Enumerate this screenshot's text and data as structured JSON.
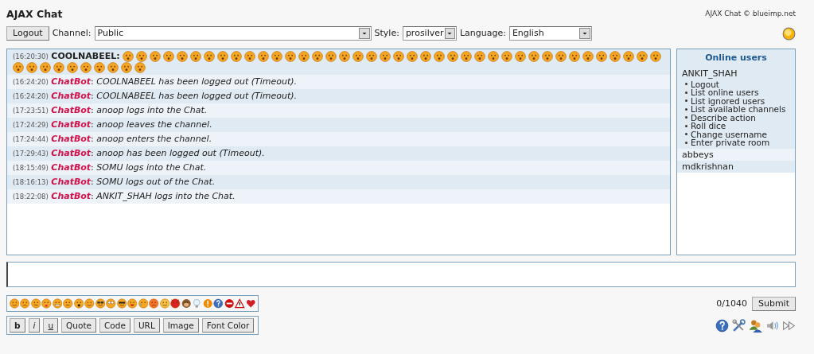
{
  "header": {
    "title": "AJAX Chat",
    "credit": "AJAX Chat © blueimp.net"
  },
  "toolbar": {
    "logout": "Logout",
    "channel_label": "Channel:",
    "channel": "Public",
    "style_label": "Style:",
    "style": "prosilver",
    "language_label": "Language:",
    "language": "English"
  },
  "messages": [
    {
      "time": "(16:20:30)",
      "kind": "user",
      "user": "COOLNABEEL:"
    },
    {
      "time": "(16:24:20)",
      "kind": "bot",
      "user": "ChatBot",
      "separator": ":",
      "text": "COOLNABEEL has been logged out (Timeout)."
    },
    {
      "time": "(16:24:20)",
      "kind": "bot",
      "user": "ChatBot",
      "separator": ":",
      "text": "COOLNABEEL has been logged out (Timeout)."
    },
    {
      "time": "(17:23:51)",
      "kind": "bot",
      "user": "ChatBot",
      "separator": ":",
      "text": "anoop logs into the Chat."
    },
    {
      "time": "(17:24:29)",
      "kind": "bot",
      "user": "ChatBot",
      "separator": ":",
      "text": "anoop leaves the channel."
    },
    {
      "time": "(17:24:44)",
      "kind": "bot",
      "user": "ChatBot",
      "separator": ":",
      "text": "anoop enters the channel."
    },
    {
      "time": "(17:29:43)",
      "kind": "bot",
      "user": "ChatBot",
      "separator": ":",
      "text": "anoop has been logged out (Timeout)."
    },
    {
      "time": "(18:15:49)",
      "kind": "bot",
      "user": "ChatBot",
      "separator": ":",
      "text": "SOMU logs into the Chat."
    },
    {
      "time": "(18:16:13)",
      "kind": "bot",
      "user": "ChatBot",
      "separator": ":",
      "text": "SOMU logs out of the Chat."
    },
    {
      "time": "(18:22:08)",
      "kind": "bot",
      "user": "ChatBot",
      "separator": ":",
      "text": "ANKIT_SHAH logs into the Chat."
    }
  ],
  "online_users": {
    "title": "Online users",
    "users": [
      {
        "name": "ANKIT_SHAH",
        "expanded": true,
        "actions": [
          "Logout",
          "List online users",
          "List ignored users",
          "List available channels",
          "Describe action",
          "Roll dice",
          "Change username",
          "Enter private room"
        ]
      },
      {
        "name": "abbeys",
        "expanded": false
      },
      {
        "name": "mdkrishnan",
        "expanded": false
      }
    ]
  },
  "composer": {
    "counter": "0/1040",
    "submit": "Submit"
  },
  "bbcode_buttons": [
    {
      "label": "b",
      "kind": "bold"
    },
    {
      "label": "i",
      "kind": "italic"
    },
    {
      "label": "u",
      "kind": "underline"
    },
    {
      "label": "Quote",
      "kind": "plain"
    },
    {
      "label": "Code",
      "kind": "plain"
    },
    {
      "label": "URL",
      "kind": "plain"
    },
    {
      "label": "Image",
      "kind": "plain"
    },
    {
      "label": "Font Color",
      "kind": "plain"
    }
  ]
}
